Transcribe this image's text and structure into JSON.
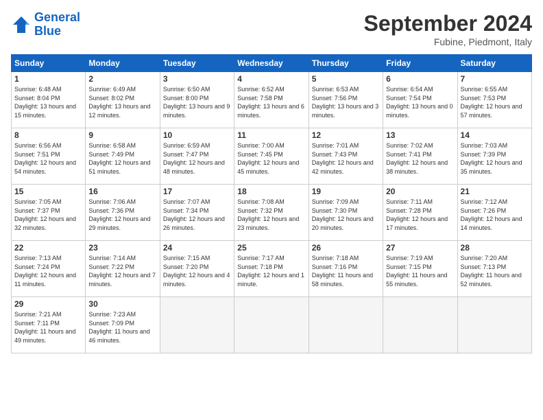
{
  "header": {
    "logo_line1": "General",
    "logo_line2": "Blue",
    "month": "September 2024",
    "location": "Fubine, Piedmont, Italy"
  },
  "weekdays": [
    "Sunday",
    "Monday",
    "Tuesday",
    "Wednesday",
    "Thursday",
    "Friday",
    "Saturday"
  ],
  "weeks": [
    [
      {
        "day": "1",
        "sunrise": "6:48 AM",
        "sunset": "8:04 PM",
        "daylight": "13 hours and 15 minutes."
      },
      {
        "day": "2",
        "sunrise": "6:49 AM",
        "sunset": "8:02 PM",
        "daylight": "13 hours and 12 minutes."
      },
      {
        "day": "3",
        "sunrise": "6:50 AM",
        "sunset": "8:00 PM",
        "daylight": "13 hours and 9 minutes."
      },
      {
        "day": "4",
        "sunrise": "6:52 AM",
        "sunset": "7:58 PM",
        "daylight": "13 hours and 6 minutes."
      },
      {
        "day": "5",
        "sunrise": "6:53 AM",
        "sunset": "7:56 PM",
        "daylight": "13 hours and 3 minutes."
      },
      {
        "day": "6",
        "sunrise": "6:54 AM",
        "sunset": "7:54 PM",
        "daylight": "13 hours and 0 minutes."
      },
      {
        "day": "7",
        "sunrise": "6:55 AM",
        "sunset": "7:53 PM",
        "daylight": "12 hours and 57 minutes."
      }
    ],
    [
      {
        "day": "8",
        "sunrise": "6:56 AM",
        "sunset": "7:51 PM",
        "daylight": "12 hours and 54 minutes."
      },
      {
        "day": "9",
        "sunrise": "6:58 AM",
        "sunset": "7:49 PM",
        "daylight": "12 hours and 51 minutes."
      },
      {
        "day": "10",
        "sunrise": "6:59 AM",
        "sunset": "7:47 PM",
        "daylight": "12 hours and 48 minutes."
      },
      {
        "day": "11",
        "sunrise": "7:00 AM",
        "sunset": "7:45 PM",
        "daylight": "12 hours and 45 minutes."
      },
      {
        "day": "12",
        "sunrise": "7:01 AM",
        "sunset": "7:43 PM",
        "daylight": "12 hours and 42 minutes."
      },
      {
        "day": "13",
        "sunrise": "7:02 AM",
        "sunset": "7:41 PM",
        "daylight": "12 hours and 38 minutes."
      },
      {
        "day": "14",
        "sunrise": "7:03 AM",
        "sunset": "7:39 PM",
        "daylight": "12 hours and 35 minutes."
      }
    ],
    [
      {
        "day": "15",
        "sunrise": "7:05 AM",
        "sunset": "7:37 PM",
        "daylight": "12 hours and 32 minutes."
      },
      {
        "day": "16",
        "sunrise": "7:06 AM",
        "sunset": "7:36 PM",
        "daylight": "12 hours and 29 minutes."
      },
      {
        "day": "17",
        "sunrise": "7:07 AM",
        "sunset": "7:34 PM",
        "daylight": "12 hours and 26 minutes."
      },
      {
        "day": "18",
        "sunrise": "7:08 AM",
        "sunset": "7:32 PM",
        "daylight": "12 hours and 23 minutes."
      },
      {
        "day": "19",
        "sunrise": "7:09 AM",
        "sunset": "7:30 PM",
        "daylight": "12 hours and 20 minutes."
      },
      {
        "day": "20",
        "sunrise": "7:11 AM",
        "sunset": "7:28 PM",
        "daylight": "12 hours and 17 minutes."
      },
      {
        "day": "21",
        "sunrise": "7:12 AM",
        "sunset": "7:26 PM",
        "daylight": "12 hours and 14 minutes."
      }
    ],
    [
      {
        "day": "22",
        "sunrise": "7:13 AM",
        "sunset": "7:24 PM",
        "daylight": "12 hours and 11 minutes."
      },
      {
        "day": "23",
        "sunrise": "7:14 AM",
        "sunset": "7:22 PM",
        "daylight": "12 hours and 7 minutes."
      },
      {
        "day": "24",
        "sunrise": "7:15 AM",
        "sunset": "7:20 PM",
        "daylight": "12 hours and 4 minutes."
      },
      {
        "day": "25",
        "sunrise": "7:17 AM",
        "sunset": "7:18 PM",
        "daylight": "12 hours and 1 minute."
      },
      {
        "day": "26",
        "sunrise": "7:18 AM",
        "sunset": "7:16 PM",
        "daylight": "11 hours and 58 minutes."
      },
      {
        "day": "27",
        "sunrise": "7:19 AM",
        "sunset": "7:15 PM",
        "daylight": "11 hours and 55 minutes."
      },
      {
        "day": "28",
        "sunrise": "7:20 AM",
        "sunset": "7:13 PM",
        "daylight": "11 hours and 52 minutes."
      }
    ],
    [
      {
        "day": "29",
        "sunrise": "7:21 AM",
        "sunset": "7:11 PM",
        "daylight": "11 hours and 49 minutes."
      },
      {
        "day": "30",
        "sunrise": "7:23 AM",
        "sunset": "7:09 PM",
        "daylight": "11 hours and 46 minutes."
      },
      null,
      null,
      null,
      null,
      null
    ]
  ]
}
